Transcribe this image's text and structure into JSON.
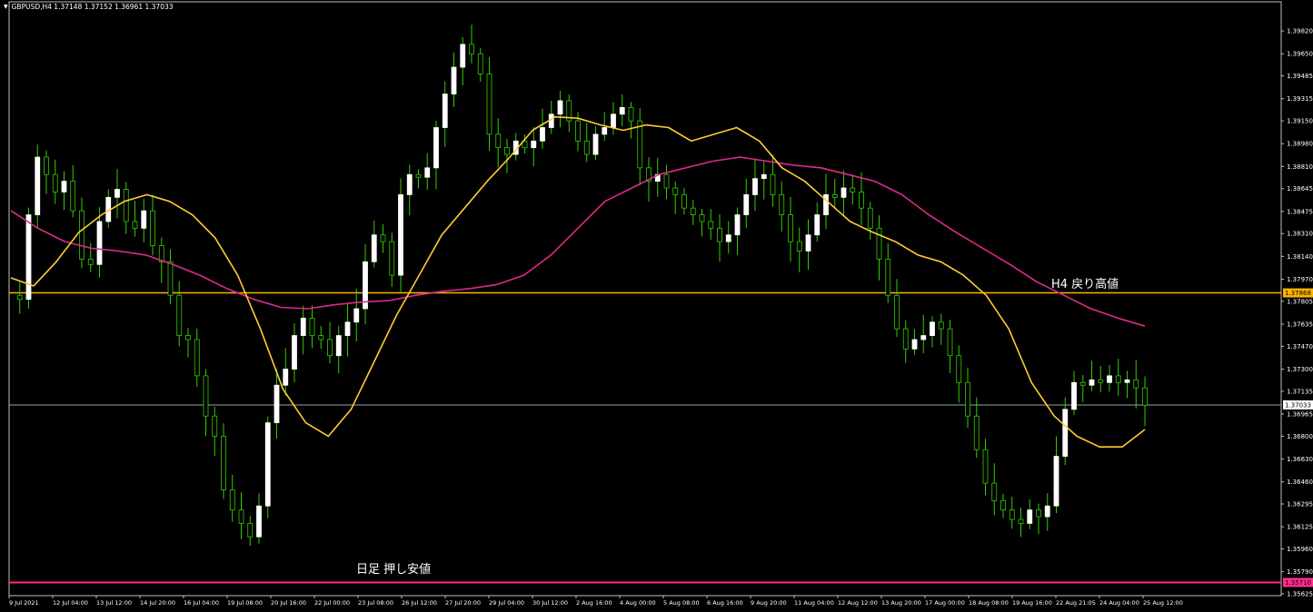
{
  "window": {
    "symbol_info": "GBPUSD,H4  1.37148 1.37152 1.36961 1.37033"
  },
  "notes": {
    "h4_resistance": "H4  戻り高値",
    "daily_support": "日足  押し安値"
  },
  "colors": {
    "background": "#000000",
    "bull_candle": "#ffffff",
    "wick": "#33cc00",
    "frame": "#c0c0c0",
    "ma_short": "#ffcc33",
    "ma_long": "#e0298c",
    "h4_line": "#ffb300",
    "daily_line": "#ff2d8c",
    "current_price_line": "#8fa3b3"
  },
  "chart_data": {
    "type": "candlestick",
    "symbol": "GBPUSD",
    "timeframe": "H4",
    "ylim": [
      1.35625,
      1.3999
    ],
    "y_ticks": [
      "1.39820",
      "1.39650",
      "1.39485",
      "1.39315",
      "1.39150",
      "1.38980",
      "1.38810",
      "1.38645",
      "1.38475",
      "1.38310",
      "1.38140",
      "1.37970",
      "1.37805",
      "1.37635",
      "1.37470",
      "1.37300",
      "1.37135",
      "1.36965",
      "1.36800",
      "1.36630",
      "1.36460",
      "1.36295",
      "1.36125",
      "1.35960",
      "1.35790",
      "1.35625"
    ],
    "x_ticks": [
      "9 Jul 2021",
      "12 Jul 04:00",
      "13 Jul 12:00",
      "14 Jul 20:00",
      "16 Jul 04:00",
      "19 Jul 08:00",
      "20 Jul 16:00",
      "22 Jul 00:00",
      "23 Jul 08:00",
      "26 Jul 12:00",
      "27 Jul 20:00",
      "29 Jul 04:00",
      "30 Jul 12:00",
      "2 Aug 16:00",
      "4 Aug 00:00",
      "5 Aug 08:00",
      "6 Aug 16:00",
      "9 Aug 20:00",
      "11 Aug 04:00",
      "12 Aug 12:00",
      "13 Aug 20:00",
      "17 Aug 00:00",
      "18 Aug 08:00",
      "19 Aug 16:00",
      "22 Aug 21:05",
      "24 Aug 04:00",
      "25 Aug 12:00"
    ],
    "price_levels": [
      {
        "name": "H4 resistance",
        "value": 1.37868,
        "label": "1.37868"
      },
      {
        "name": "current",
        "value": 1.37033,
        "label": "1.37033"
      },
      {
        "name": "daily support",
        "value": 1.3571,
        "label": "1.35710"
      }
    ],
    "close_path": [
      1.3785,
      1.3782,
      1.3845,
      1.3888,
      1.3875,
      1.3862,
      1.387,
      1.3848,
      1.3812,
      1.3808,
      1.384,
      1.3858,
      1.3864,
      1.384,
      1.3835,
      1.3848,
      1.3822,
      1.381,
      1.3785,
      1.3755,
      1.3752,
      1.3725,
      1.3695,
      1.368,
      1.364,
      1.3625,
      1.3615,
      1.3605,
      1.3628,
      1.369,
      1.3718,
      1.373,
      1.3755,
      1.3768,
      1.3755,
      1.3752,
      1.374,
      1.3755,
      1.3765,
      1.3775,
      1.381,
      1.383,
      1.3825,
      1.38,
      1.386,
      1.3875,
      1.3873,
      1.388,
      1.391,
      1.3935,
      1.3955,
      1.3972,
      1.3965,
      1.395,
      1.3905,
      1.3895,
      1.389,
      1.39,
      1.3895,
      1.39,
      1.391,
      1.392,
      1.393,
      1.3915,
      1.39,
      1.389,
      1.3905,
      1.391,
      1.392,
      1.3925,
      1.3915,
      1.388,
      1.387,
      1.3875,
      1.3865,
      1.386,
      1.385,
      1.3845,
      1.384,
      1.3835,
      1.3825,
      1.383,
      1.3845,
      1.386,
      1.3872,
      1.3875,
      1.386,
      1.3845,
      1.3825,
      1.3818,
      1.383,
      1.3845,
      1.386,
      1.3858,
      1.3865,
      1.3862,
      1.385,
      1.3835,
      1.3812,
      1.3785,
      1.376,
      1.3745,
      1.3752,
      1.3755,
      1.3765,
      1.376,
      1.374,
      1.372,
      1.3695,
      1.367,
      1.3645,
      1.3632,
      1.3625,
      1.3618,
      1.3615,
      1.3625,
      1.362,
      1.3628,
      1.3665,
      1.37,
      1.372,
      1.3718,
      1.3722,
      1.372,
      1.3725,
      1.372,
      1.3722,
      1.3716,
      1.3703
    ],
    "ma_short": [
      1.3798,
      1.3792,
      1.381,
      1.3832,
      1.3845,
      1.3855,
      1.386,
      1.3855,
      1.3845,
      1.3828,
      1.38,
      1.376,
      1.3715,
      1.369,
      1.368,
      1.37,
      1.3735,
      1.377,
      1.38,
      1.383,
      1.385,
      1.387,
      1.3888,
      1.3908,
      1.3918,
      1.3917,
      1.3912,
      1.3908,
      1.3912,
      1.391,
      1.39,
      1.3905,
      1.391,
      1.39,
      1.388,
      1.387,
      1.3855,
      1.384,
      1.3832,
      1.3825,
      1.3815,
      1.381,
      1.38,
      1.3785,
      1.376,
      1.372,
      1.3695,
      1.368,
      1.3672,
      1.3672,
      1.3685
    ],
    "ma_long": [
      1.3848,
      1.3835,
      1.3825,
      1.382,
      1.3818,
      1.3815,
      1.3808,
      1.38,
      1.379,
      1.3782,
      1.3776,
      1.3775,
      1.3778,
      1.378,
      1.3781,
      1.3785,
      1.3788,
      1.379,
      1.3793,
      1.38,
      1.3815,
      1.3835,
      1.3855,
      1.3865,
      1.3875,
      1.388,
      1.3885,
      1.3888,
      1.3885,
      1.3882,
      1.388,
      1.3875,
      1.387,
      1.386,
      1.3845,
      1.3832,
      1.382,
      1.3808,
      1.3795,
      1.3785,
      1.3775,
      1.3768,
      1.3762
    ],
    "grid": false,
    "legend": "none"
  }
}
